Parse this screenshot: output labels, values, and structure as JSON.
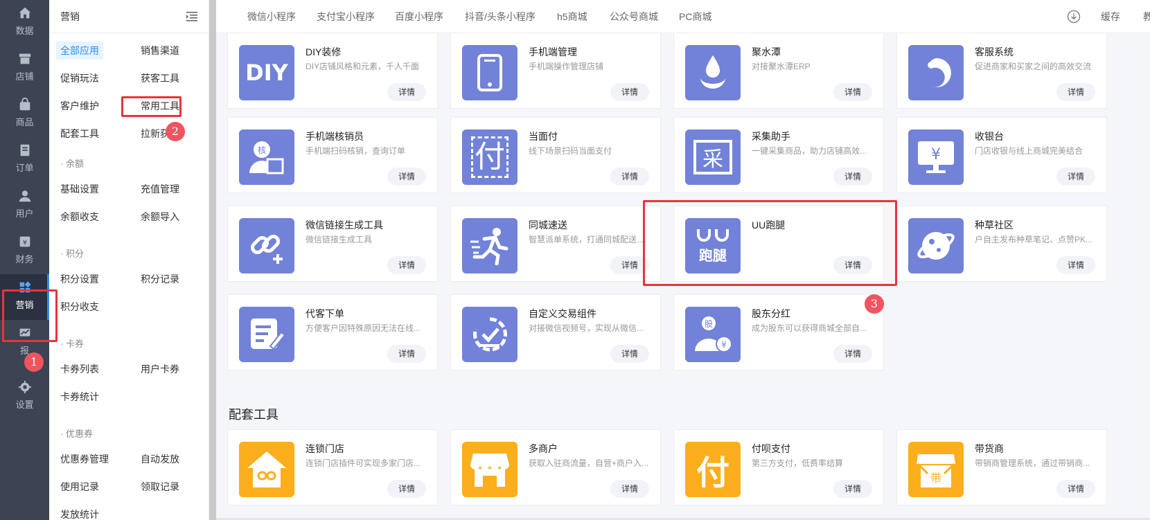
{
  "rail": [
    {
      "label": "数据",
      "icon": "home-icon"
    },
    {
      "label": "店铺",
      "icon": "store-icon"
    },
    {
      "label": "商品",
      "icon": "bag-icon"
    },
    {
      "label": "订单",
      "icon": "order-icon"
    },
    {
      "label": "用户",
      "icon": "user-icon"
    },
    {
      "label": "财务",
      "icon": "finance-icon"
    },
    {
      "label": "营销",
      "icon": "marketing-icon",
      "active": true
    },
    {
      "label": "报",
      "icon": "report-icon"
    },
    {
      "label": "设置",
      "icon": "gear-icon"
    }
  ],
  "submenu": {
    "title": "营销",
    "items": {
      "all_apps": "全部应用",
      "sales_channel": "销售渠道",
      "promo": "促销玩法",
      "acquire": "获客工具",
      "retention": "客户维护",
      "common_tools": "常用工具",
      "supporting": "配套工具",
      "pull_new": "拉新获",
      "balance_section": "· 余额",
      "basic_settings": "基础设置",
      "recharge": "充值管理",
      "balance_in_out": "余额收支",
      "balance_import": "余额导入",
      "points_section": "· 积分",
      "points_settings": "积分设置",
      "points_record": "积分记录",
      "points_in_out": "积分收支",
      "card_section": "· 卡券",
      "card_list": "卡券列表",
      "user_card": "用户卡券",
      "card_stats": "卡券统计",
      "coupon_section": "· 优惠券",
      "coupon_mgmt": "优惠券管理",
      "auto_issue": "自动发放",
      "usage_record": "使用记录",
      "claim_record": "领取记录",
      "issue_stats": "发放统计"
    }
  },
  "topbar": {
    "tabs": [
      "微信小程序",
      "支付宝小程序",
      "百度小程序",
      "抖音/头条小程序",
      "h5商城",
      "公众号商城",
      "PC商城"
    ],
    "cache_label": "缓存",
    "cut_label": "教"
  },
  "detail_label": "详情",
  "cards": [
    {
      "name": "DIY装修",
      "desc": "DIY店铺风格和元素，千人千面",
      "icon": "diy-icon",
      "glyph": "DIY"
    },
    {
      "name": "手机端管理",
      "desc": "手机端操作管理店铺",
      "icon": "phone-icon"
    },
    {
      "name": "聚水潭",
      "desc": "对接聚水潭ERP",
      "icon": "water-drop-icon"
    },
    {
      "name": "客服系统",
      "desc": "促进商家和买家之间的高效交流",
      "icon": "customer-service-icon"
    },
    {
      "name": "手机端核销员",
      "desc": "手机端扫码核销，查询订单",
      "icon": "verifier-icon",
      "glyph": "核"
    },
    {
      "name": "当面付",
      "desc": "线下场景扫码当面支付",
      "icon": "pay-icon",
      "glyph": "付"
    },
    {
      "name": "采集助手",
      "desc": "一键采集商品，助力店铺高效...",
      "icon": "collect-icon",
      "glyph": "采"
    },
    {
      "name": "收银台",
      "desc": "门店收银与线上商城完美结合",
      "icon": "cashier-icon",
      "glyph": "¥"
    },
    {
      "name": "微信链接生成工具",
      "desc": "微信链接生成工具",
      "icon": "link-icon"
    },
    {
      "name": "同城速送",
      "desc": "智慧派单系统，打通同城配送...",
      "icon": "runner-icon"
    },
    {
      "name": "UU跑腿",
      "desc": "",
      "icon": "uu-icon",
      "glyph": "跑腿"
    },
    {
      "name": "种草社区",
      "desc": "户自主发布种草笔记、点赞PK...",
      "icon": "planet-icon"
    },
    {
      "name": "代客下单",
      "desc": "方便客户因特殊原因无法在线...",
      "icon": "edit-order-icon"
    },
    {
      "name": "自定义交易组件",
      "desc": "对接微信视频号，实现从微信...",
      "icon": "trade-component-icon"
    },
    {
      "name": "股东分红",
      "desc": "成为股东可以获得商城全部自...",
      "icon": "shareholder-icon",
      "glyph": "股"
    }
  ],
  "supporting_section": {
    "title": "配套工具",
    "cards": [
      {
        "name": "连锁门店",
        "desc": "连锁门店插件可实现多家门店...",
        "icon": "chain-store-icon"
      },
      {
        "name": "多商户",
        "desc": "获取入驻商流量，自营+商户入...",
        "icon": "multi-merchant-icon"
      },
      {
        "name": "付呗支付",
        "desc": "第三方支付，低费率结算",
        "icon": "fubei-pay-icon",
        "glyph": "付"
      },
      {
        "name": "带货商",
        "desc": "带销商管理系统，通过带销商...",
        "icon": "seller-icon",
        "glyph": "带"
      }
    ]
  },
  "annotations": [
    "1",
    "2",
    "3"
  ],
  "colors": {
    "accent": "#2d8cf0",
    "icon_blue": "#7282d8",
    "icon_orange": "#fcae1c",
    "highlight": "#e8343c"
  }
}
